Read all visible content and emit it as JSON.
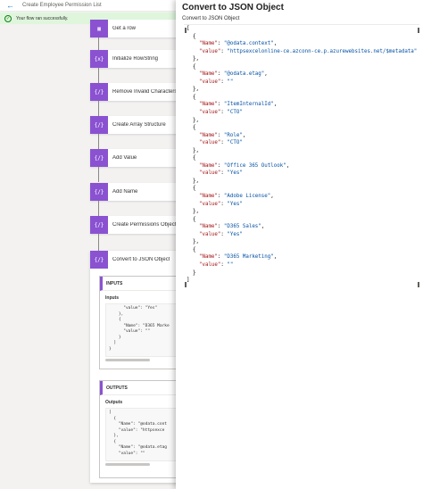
{
  "topbar": {
    "flow_title": "Create Employee Permission List",
    "back_icon": "back-arrow-icon"
  },
  "banner": {
    "message": "Your flow ran successfully.",
    "icon": "check-circle-icon",
    "color": "#107c10"
  },
  "steps": [
    {
      "label": "Get a row"
    },
    {
      "label": "Initialize RowString"
    },
    {
      "label": "Remove Invalid Characters"
    },
    {
      "label": "Create Array Structure"
    },
    {
      "label": "Add Value"
    },
    {
      "label": "Add Name"
    },
    {
      "label": "Create Permissions Object"
    }
  ],
  "expanded_step": {
    "label": "Convert to JSON Object",
    "inputs": {
      "header": "INPUTS",
      "sub": "Inputs",
      "code": "      \"value\": \"Yes\"\n    },\n    {\n      \"Name\": \"D365 Marke\n      \"value\": \"\"\n    }\n  ]\n}"
    },
    "outputs": {
      "header": "OUTPUTS",
      "sub": "Outputs",
      "code": "[\n  {\n    \"Name\": \"@odata.cont\n    \"value\": \"httpsexce\n  },\n  {\n    \"Name\": \"@odata.etag\n    \"value\": \"\""
    }
  },
  "panel": {
    "title": "Convert to JSON Object",
    "subtitle": "Convert to JSON Object",
    "json": [
      {
        "name": "@odata.context",
        "value": "httpsexcelonline-ce.azconn-ce.p.azurewebsites.net/$metadata"
      },
      {
        "name": "@odata.etag",
        "value": ""
      },
      {
        "name": "ItemInternalId",
        "value": "CTO"
      },
      {
        "name": "Role",
        "value": "CTO"
      },
      {
        "name": "Office 365 Outlook",
        "value": "Yes"
      },
      {
        "name": "Adobe License",
        "value": "Yes"
      },
      {
        "name": "D365 Sales",
        "value": "Yes"
      },
      {
        "name": "D365 Marketing",
        "value": ""
      }
    ]
  },
  "colors": {
    "accent": "#8a52d1",
    "link": "#0078d4"
  }
}
